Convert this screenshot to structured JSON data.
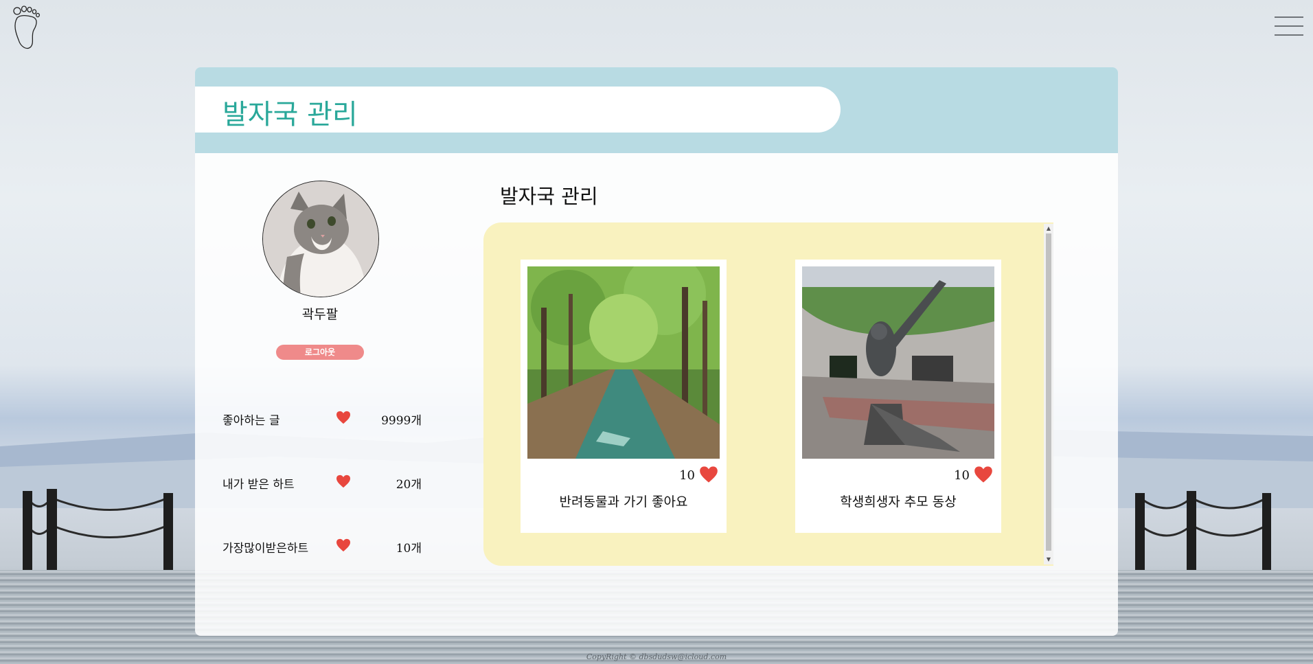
{
  "header": {
    "page_title": "발자국 관리",
    "menu_icon": "hamburger-menu-icon",
    "logo_icon": "footprint-icon"
  },
  "profile": {
    "name": "곽두팔",
    "logout_label": "로그아웃",
    "avatar_icon": "cat-avatar"
  },
  "stats": [
    {
      "label": "좋아하는 글",
      "value": "9999개"
    },
    {
      "label": "내가 받은 하트",
      "value": "20개"
    },
    {
      "label": "가장많이받은하트",
      "value": "10개"
    }
  ],
  "main": {
    "section_title": "발자국 관리",
    "posts": [
      {
        "title": "반려동물과 가기 좋아요",
        "likes": "10"
      },
      {
        "title": "학생희생자 추모 동상",
        "likes": "10"
      }
    ]
  },
  "footer": {
    "copyright": "CopyRight © dbsdudsw@icloud.com"
  },
  "colors": {
    "accent": "#2aa89a",
    "header_band": "#b8dbe3",
    "gallery_bg": "#f9f2bf",
    "logout": "#ef8a8a",
    "heart": "#e8473e"
  }
}
